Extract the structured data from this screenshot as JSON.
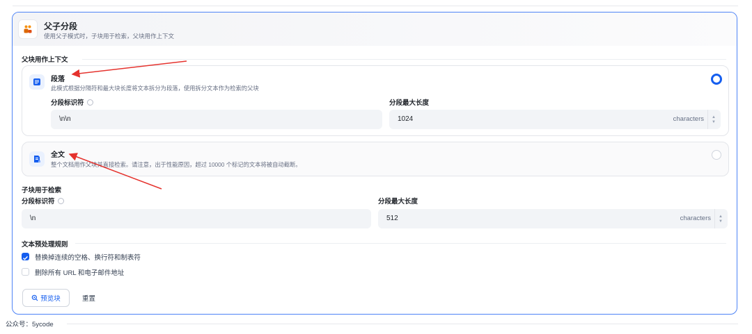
{
  "header": {
    "title": "父子分段",
    "description": "使用父子模式时，子块用于检索，父块用作上下文"
  },
  "parent_section": {
    "label": "父块用作上下文",
    "options": [
      {
        "title": "段落",
        "description": "此模式根据分隔符和最大块长度将文本拆分为段落，使用拆分文本作为检索的父块",
        "selected": true,
        "delimiter_label": "分段标识符",
        "delimiter_value": "\\n\\n",
        "max_length_label": "分段最大长度",
        "max_length_value": "1024",
        "max_length_unit": "characters"
      },
      {
        "title": "全文",
        "description": "整个文档用作父块并直接检索。请注意，出于性能原因，超过 10000 个标记的文本将被自动截断。",
        "selected": false
      }
    ]
  },
  "child_section": {
    "label": "子块用于检索",
    "delimiter_label": "分段标识符",
    "delimiter_value": "\\n",
    "max_length_label": "分段最大长度",
    "max_length_value": "512",
    "max_length_unit": "characters"
  },
  "preprocess": {
    "label": "文本预处理规则",
    "rules": [
      {
        "label": "替换掉连续的空格、换行符和制表符",
        "checked": true
      },
      {
        "label": "删除所有 URL 和电子邮件地址",
        "checked": false
      }
    ]
  },
  "actions": {
    "preview_label": "预览块",
    "reset_label": "重置"
  },
  "footer": {
    "text": "公众号：5ycode"
  },
  "colors": {
    "accent": "#155eef",
    "card_border": "#4d83f6",
    "annotation_arrow": "#e5322d"
  },
  "icons": {
    "header": "parent-child-icon",
    "paragraph": "paragraph-doc-icon",
    "fulltext": "fulltext-doc-icon",
    "help": "question-circle-icon",
    "preview": "search-zoom-icon"
  }
}
